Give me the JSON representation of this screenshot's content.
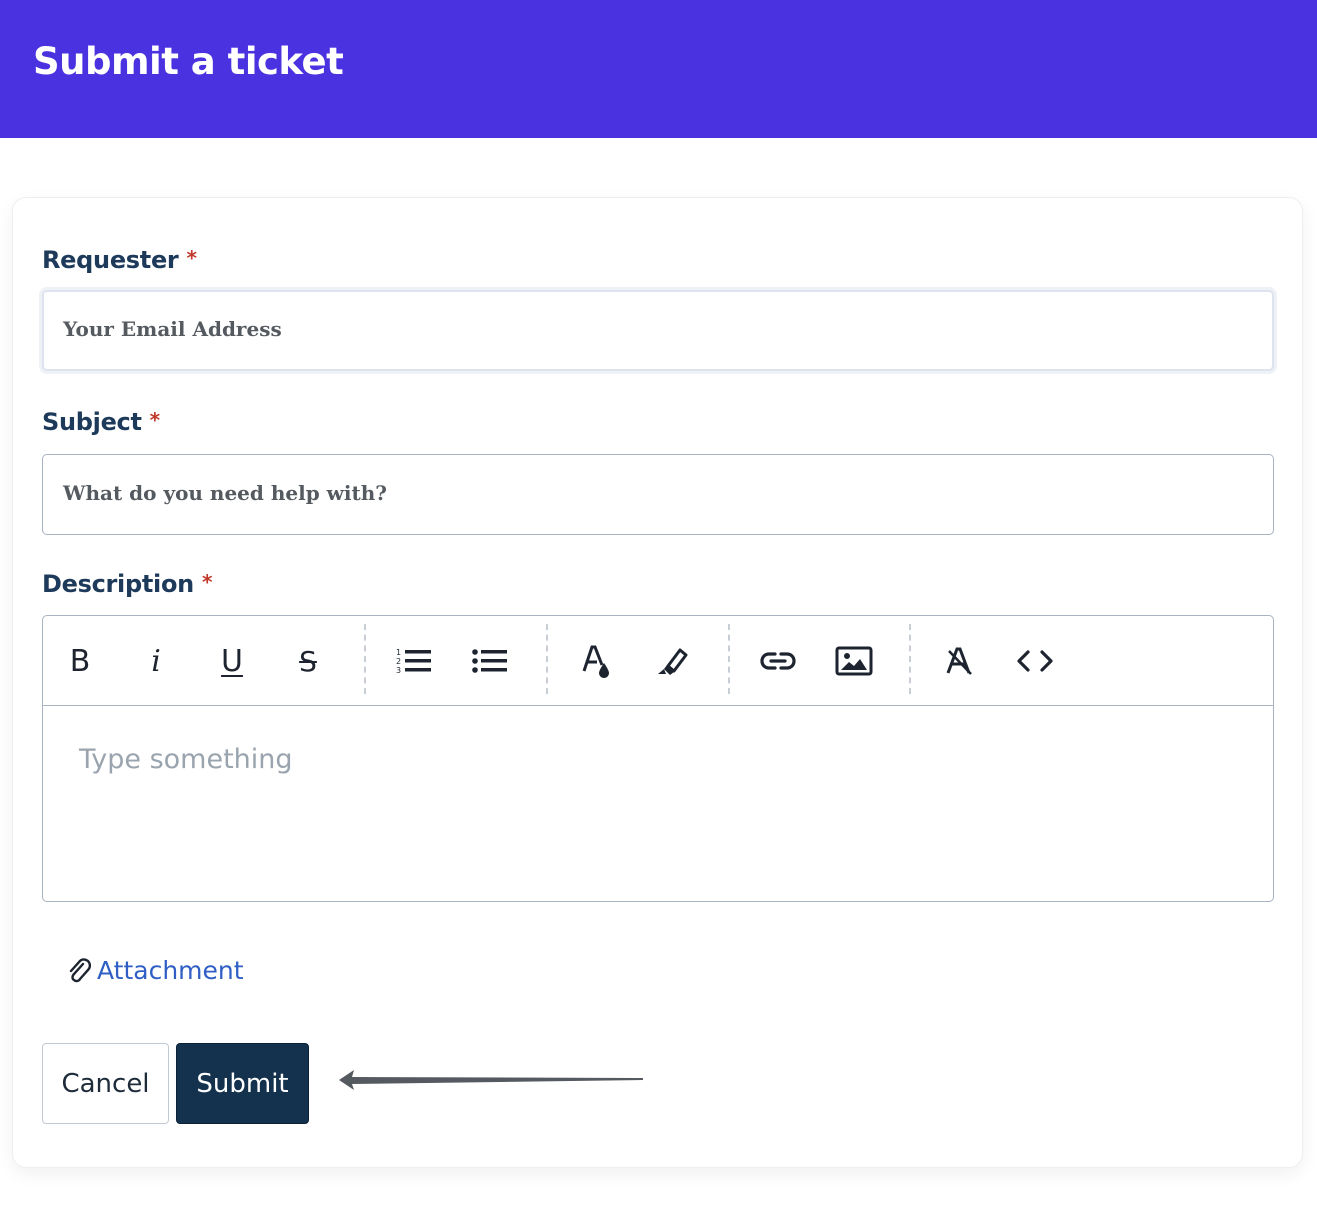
{
  "header": {
    "title": "Submit a ticket",
    "bg_color": "#4b32e0"
  },
  "form": {
    "requester": {
      "label": "Requester",
      "required_mark": "*",
      "placeholder": "Your Email Address"
    },
    "subject": {
      "label": "Subject",
      "required_mark": "*",
      "placeholder": "What do you need help with?"
    },
    "description": {
      "label": "Description",
      "required_mark": "*",
      "placeholder": "Type something",
      "toolbar": [
        {
          "icon": "bold-icon",
          "glyph": "B"
        },
        {
          "icon": "italic-icon",
          "glyph": "i"
        },
        {
          "icon": "underline-icon",
          "glyph": "U"
        },
        {
          "icon": "strikethrough-icon",
          "glyph": "S"
        },
        {
          "icon": "ordered-list-icon"
        },
        {
          "icon": "bullet-list-icon"
        },
        {
          "icon": "text-color-icon"
        },
        {
          "icon": "highlight-icon"
        },
        {
          "icon": "link-icon"
        },
        {
          "icon": "image-icon"
        },
        {
          "icon": "clear-format-icon"
        },
        {
          "icon": "code-icon"
        }
      ]
    },
    "attachment": {
      "label": "Attachment",
      "icon": "paperclip-icon"
    },
    "actions": {
      "cancel_label": "Cancel",
      "submit_label": "Submit"
    }
  },
  "colors": {
    "accent": "#4b32e0",
    "submit_bg": "#14324e",
    "link": "#2f5fc4",
    "required": "#c0392b",
    "label": "#1d3a5a"
  }
}
